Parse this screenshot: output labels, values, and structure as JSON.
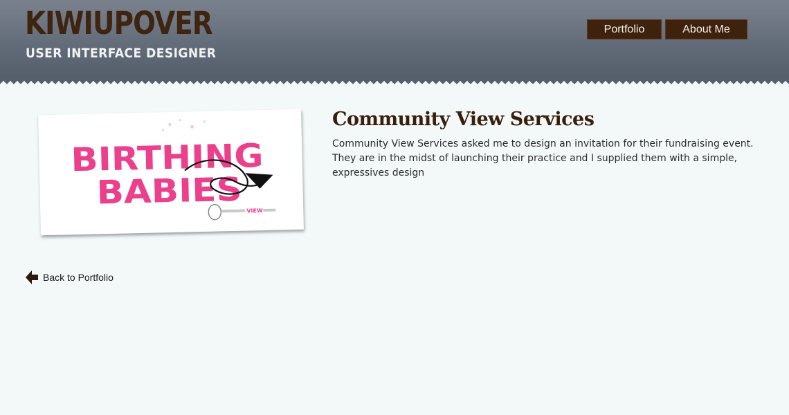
{
  "header": {
    "logo_title": "KIWIUPOVER",
    "logo_subtitle": "USER INTERFACE DESIGNER",
    "nav": [
      {
        "label": "Portfolio"
      },
      {
        "label": "About Me"
      }
    ]
  },
  "project": {
    "title": "Community View Services",
    "description": "Community View Services asked me to design an invitation for their fundraising event. They are in the midst of launching their practice and I supplied them with a simple, expressives design",
    "image": {
      "headline_line1": "BIRTHING",
      "headline_line2": "BABIES",
      "brand": "VIEW"
    }
  },
  "back_link": {
    "label": "Back to Portfolio",
    "icon": "arrow-left-icon"
  },
  "colors": {
    "header_top": "#7a828e",
    "header_bottom": "#545d6a",
    "brown": "#3f220d",
    "pink": "#ec3f8c",
    "background": "#f3f8f9"
  }
}
